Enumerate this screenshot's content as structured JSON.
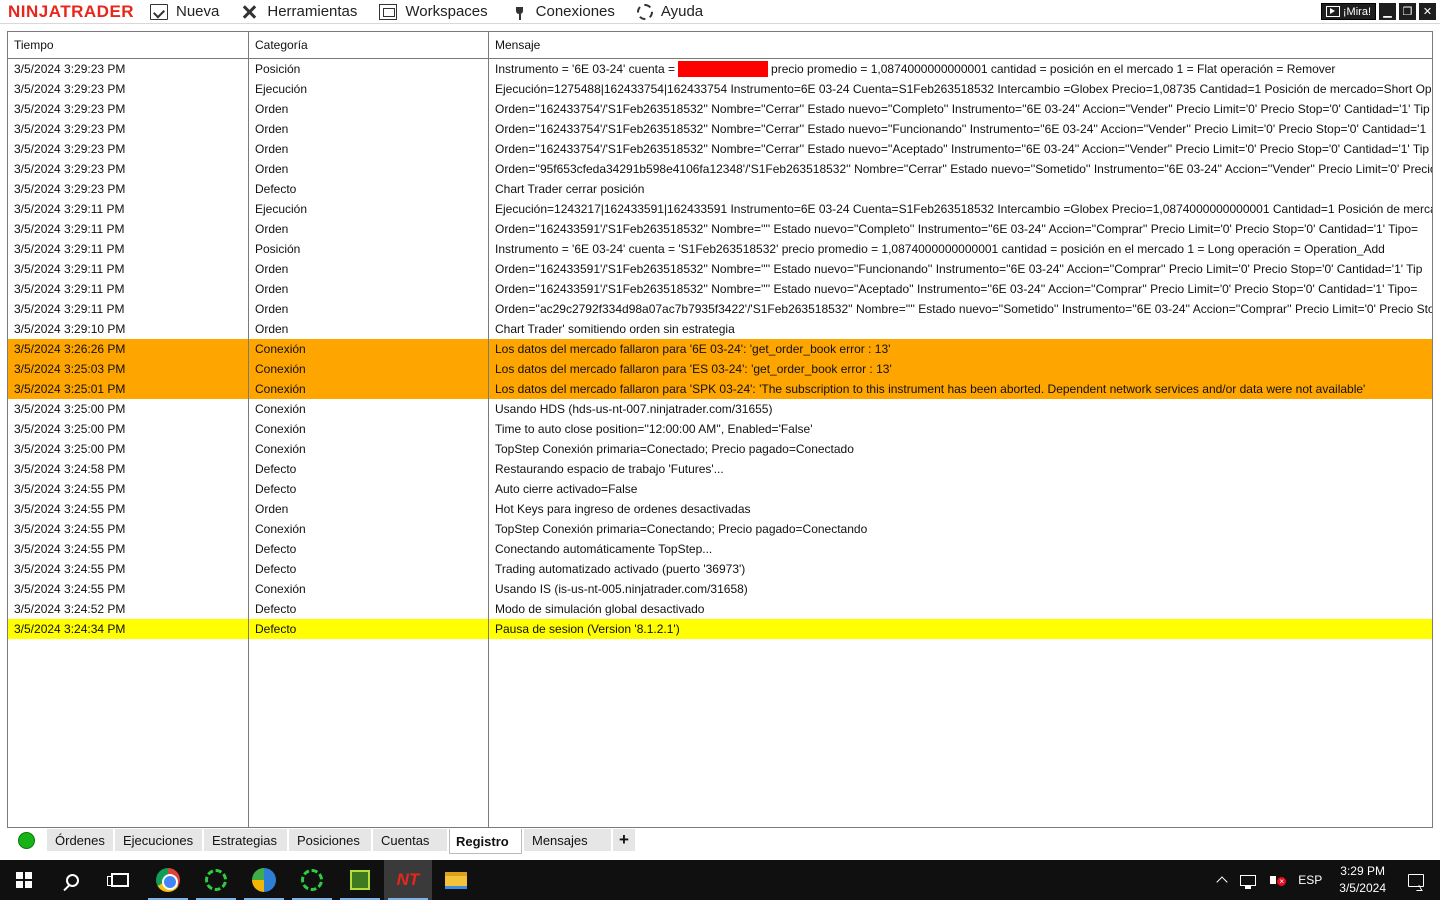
{
  "app": {
    "logo": "NINJATRADER",
    "menu": [
      {
        "label": "Nueva",
        "icon": "nueva-icon"
      },
      {
        "label": "Herramientas",
        "icon": "tools-icon"
      },
      {
        "label": "Workspaces",
        "icon": "workspaces-icon"
      },
      {
        "label": "Conexiones",
        "icon": "plug-icon"
      },
      {
        "label": "Ayuda",
        "icon": "help-icon"
      }
    ],
    "mira_label": "¡Mira!"
  },
  "log": {
    "headers": {
      "time": "Tiempo",
      "category": "Categoría",
      "message": "Mensaje"
    },
    "rows": [
      {
        "time": "3/5/2024 3:29:23 PM",
        "category": "Posición",
        "message": "Instrumento = '6E 03-24' cuenta = [REDACTED] precio promedio = 1,0874000000000001 cantidad = posición en el mercado 1 = Flat operación = Remover",
        "highlight": ""
      },
      {
        "time": "3/5/2024 3:29:23 PM",
        "category": "Ejecución",
        "message": "Ejecución=1275488|162433754|162433754 Instrumento=6E 03-24 Cuenta=S1Feb263518532 Intercambio =Globex Precio=1,08735 Cantidad=1 Posición de mercado=Short Operación",
        "highlight": ""
      },
      {
        "time": "3/5/2024 3:29:23 PM",
        "category": "Orden",
        "message": "Orden=''162433754'/'S1Feb263518532'' Nombre=''Cerrar'' Estado nuevo=''Completo'' Instrumento=''6E 03-24'' Accion=''Vender'' Precio Limit='0' Precio Stop='0' Cantidad='1' Tip",
        "highlight": ""
      },
      {
        "time": "3/5/2024 3:29:23 PM",
        "category": "Orden",
        "message": "Orden=''162433754'/'S1Feb263518532'' Nombre=''Cerrar'' Estado nuevo=''Funcionando'' Instrumento=''6E 03-24'' Accion=''Vender'' Precio Limit='0' Precio Stop='0' Cantidad='1",
        "highlight": ""
      },
      {
        "time": "3/5/2024 3:29:23 PM",
        "category": "Orden",
        "message": "Orden=''162433754'/'S1Feb263518532'' Nombre=''Cerrar'' Estado nuevo=''Aceptado'' Instrumento=''6E 03-24'' Accion=''Vender'' Precio Limit='0' Precio Stop='0' Cantidad='1' Tip",
        "highlight": ""
      },
      {
        "time": "3/5/2024 3:29:23 PM",
        "category": "Orden",
        "message": "Orden=''95f653cfeda34291b598e4106fa12348'/'S1Feb263518532'' Nombre=''Cerrar'' Estado nuevo=''Sometido'' Instrumento=''6E 03-24'' Accion=''Vender'' Precio Limit='0' Precio",
        "highlight": ""
      },
      {
        "time": "3/5/2024 3:29:23 PM",
        "category": "Defecto",
        "message": "Chart Trader cerrar posición",
        "highlight": ""
      },
      {
        "time": "3/5/2024 3:29:11 PM",
        "category": "Ejecución",
        "message": "Ejecución=1243217|162433591|162433591 Instrumento=6E 03-24 Cuenta=S1Feb263518532 Intercambio =Globex Precio=1,0874000000000001 Cantidad=1 Posición de mercado=Lo",
        "highlight": ""
      },
      {
        "time": "3/5/2024 3:29:11 PM",
        "category": "Orden",
        "message": "Orden=''162433591'/'S1Feb263518532'' Nombre='''' Estado nuevo=''Completo'' Instrumento=''6E 03-24'' Accion=''Comprar'' Precio Limit='0' Precio Stop='0' Cantidad='1' Tipo=",
        "highlight": ""
      },
      {
        "time": "3/5/2024 3:29:11 PM",
        "category": "Posición",
        "message": "Instrumento = '6E 03-24' cuenta = 'S1Feb263518532' precio promedio = 1,0874000000000001 cantidad = posición en el mercado 1 = Long operación = Operation_Add",
        "highlight": ""
      },
      {
        "time": "3/5/2024 3:29:11 PM",
        "category": "Orden",
        "message": "Orden=''162433591'/'S1Feb263518532'' Nombre='''' Estado nuevo=''Funcionando'' Instrumento=''6E 03-24'' Accion=''Comprar'' Precio Limit='0' Precio Stop='0' Cantidad='1' Tip",
        "highlight": ""
      },
      {
        "time": "3/5/2024 3:29:11 PM",
        "category": "Orden",
        "message": "Orden=''162433591'/'S1Feb263518532'' Nombre='''' Estado nuevo=''Aceptado'' Instrumento=''6E 03-24'' Accion=''Comprar'' Precio Limit='0' Precio Stop='0' Cantidad='1' Tipo=",
        "highlight": ""
      },
      {
        "time": "3/5/2024 3:29:11 PM",
        "category": "Orden",
        "message": "Orden=''ac29c2792f334d98a07ac7b7935f3422'/'S1Feb263518532'' Nombre='''' Estado nuevo=''Sometido'' Instrumento=''6E 03-24'' Accion=''Comprar'' Precio Limit='0' Precio Sto",
        "highlight": ""
      },
      {
        "time": "3/5/2024 3:29:10 PM",
        "category": "Orden",
        "message": "Chart Trader' somitiendo orden sin estrategia",
        "highlight": ""
      },
      {
        "time": "3/5/2024 3:26:26 PM",
        "category": "Conexión",
        "message": "Los datos del mercado fallaron para '6E 03-24': 'get_order_book error : 13'",
        "highlight": "orange"
      },
      {
        "time": "3/5/2024 3:25:03 PM",
        "category": "Conexión",
        "message": "Los datos del mercado fallaron para 'ES 03-24': 'get_order_book error : 13'",
        "highlight": "orange"
      },
      {
        "time": "3/5/2024 3:25:01 PM",
        "category": "Conexión",
        "message": "Los datos del mercado fallaron para 'SPK 03-24': 'The subscription to this instrument has been aborted.  Dependent network services and/or data were not available'",
        "highlight": "orange"
      },
      {
        "time": "3/5/2024 3:25:00 PM",
        "category": "Conexión",
        "message": "Usando HDS (hds-us-nt-007.ninjatrader.com/31655)",
        "highlight": ""
      },
      {
        "time": "3/5/2024 3:25:00 PM",
        "category": "Conexión",
        "message": "Time to auto close position=''12:00:00 AM'', Enabled='False'",
        "highlight": ""
      },
      {
        "time": "3/5/2024 3:25:00 PM",
        "category": "Conexión",
        "message": "TopStep Conexión primaria=Conectado; Precio pagado=Conectado",
        "highlight": ""
      },
      {
        "time": "3/5/2024 3:24:58 PM",
        "category": "Defecto",
        "message": "Restaurando espacio de trabajo 'Futures'...",
        "highlight": ""
      },
      {
        "time": "3/5/2024 3:24:55 PM",
        "category": "Defecto",
        "message": "Auto cierre activado=False",
        "highlight": ""
      },
      {
        "time": "3/5/2024 3:24:55 PM",
        "category": "Orden",
        "message": "Hot Keys para ingreso de ordenes desactivadas",
        "highlight": ""
      },
      {
        "time": "3/5/2024 3:24:55 PM",
        "category": "Conexión",
        "message": "TopStep Conexión primaria=Conectando; Precio pagado=Conectando",
        "highlight": ""
      },
      {
        "time": "3/5/2024 3:24:55 PM",
        "category": "Defecto",
        "message": "Conectando automáticamente TopStep...",
        "highlight": ""
      },
      {
        "time": "3/5/2024 3:24:55 PM",
        "category": "Defecto",
        "message": "Trading automatizado activado (puerto '36973')",
        "highlight": ""
      },
      {
        "time": "3/5/2024 3:24:55 PM",
        "category": "Conexión",
        "message": "Usando IS (is-us-nt-005.ninjatrader.com/31658)",
        "highlight": ""
      },
      {
        "time": "3/5/2024 3:24:52 PM",
        "category": "Defecto",
        "message": "Modo de simulación global desactivado",
        "highlight": ""
      },
      {
        "time": "3/5/2024 3:24:34 PM",
        "category": "Defecto",
        "message": "Pausa de sesion (Version '8.1.2.1')",
        "highlight": "yellow"
      }
    ]
  },
  "tabs": [
    {
      "label": "Órdenes",
      "active": false
    },
    {
      "label": "Ejecuciones",
      "active": false
    },
    {
      "label": "Estrategias",
      "active": false
    },
    {
      "label": "Posiciones",
      "active": false
    },
    {
      "label": "Cuentas",
      "active": false
    },
    {
      "label": "Registro",
      "active": true
    },
    {
      "label": "Mensajes",
      "active": false
    }
  ],
  "tab_add": "+",
  "taskbar": {
    "apps": [
      "windows-start-icon",
      "search-icon",
      "task-view-icon",
      "chrome-icon",
      "green-ring-app-icon",
      "metatrader-icon",
      "green-ring-app-icon-2",
      "tradingview-icon",
      "ninjatrader-icon",
      "file-explorer-icon"
    ],
    "nt_label": "NT",
    "lang": "ESP",
    "time": "3:29 PM",
    "date": "3/5/2024"
  },
  "colors": {
    "logo": "#e8261c",
    "orange_row": "#ffa500",
    "yellow_row": "#ffff00",
    "status_connected": "#16b316",
    "redaction": "#ff0000"
  }
}
